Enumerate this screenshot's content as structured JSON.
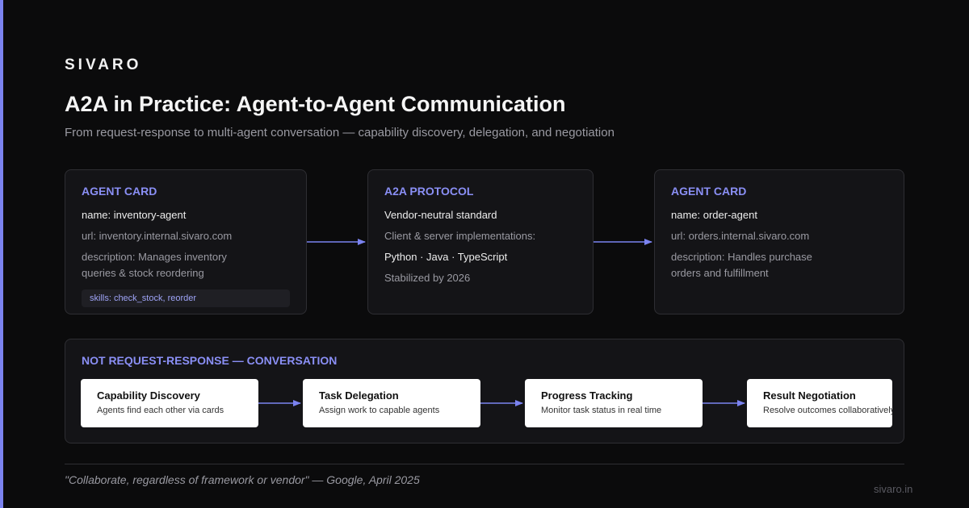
{
  "brand": "SIVARO",
  "title": "A2A in Practice: Agent-to-Agent Communication",
  "subtitle": "From request-response to multi-agent conversation — capability discovery, delegation, and negotiation",
  "colors": {
    "accent": "#7b83f0",
    "label": "#8a8ff5",
    "background": "#0b0b0c",
    "card": "#141417"
  },
  "left_card": {
    "label": "AGENT CARD",
    "name": "name: inventory-agent",
    "url": "url: inventory.internal.sivaro.com",
    "description": "description: Manages inventory queries & stock reordering",
    "skills": "skills: check_stock, reorder"
  },
  "middle_card": {
    "label": "A2A PROTOCOL",
    "line1": "Vendor-neutral standard",
    "line2": "Client & server implementations:",
    "line3": "Python · Java · TypeScript",
    "line4": "Stabilized by 2026"
  },
  "right_card": {
    "label": "AGENT CARD",
    "name": "name: order-agent",
    "url": "url: orders.internal.sivaro.com",
    "description": "description: Handles purchase orders and fulfillment"
  },
  "flow": {
    "label": "NOT REQUEST-RESPONSE — CONVERSATION",
    "steps": [
      {
        "title": "Capability Discovery",
        "desc": "Agents find each other via cards"
      },
      {
        "title": "Task Delegation",
        "desc": "Assign work to capable agents"
      },
      {
        "title": "Progress Tracking",
        "desc": "Monitor task status in real time"
      },
      {
        "title": "Result Negotiation",
        "desc": "Resolve outcomes collaboratively"
      }
    ]
  },
  "quote": "\"Collaborate, regardless of framework or vendor\" — Google, April 2025",
  "footer_url": "sivaro.in"
}
